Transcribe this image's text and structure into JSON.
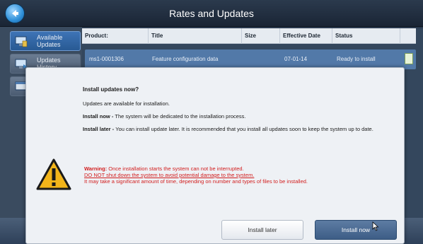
{
  "window": {
    "title": "Rates and Updates"
  },
  "sidebar": {
    "items": [
      {
        "label_line1": "Available",
        "label_line2": "Updates",
        "active": true
      },
      {
        "label_line1": "Updates",
        "label_line2": "History",
        "active": false
      },
      {
        "label_line1": "",
        "label_line2": "",
        "active": false
      }
    ]
  },
  "table": {
    "columns": [
      "Product:",
      "Title",
      "Size",
      "Effective Date",
      "Status"
    ],
    "rows": [
      {
        "product": "ms1-0001306",
        "title": "Feature configuration data",
        "size": "",
        "effective_date": "07-01-14",
        "status": "Ready to install"
      }
    ]
  },
  "dialog": {
    "heading": "Install updates now?",
    "available_text": "Updates are available for installation.",
    "install_now_label": "Install now - ",
    "install_now_text": "The system will be dedicated to the installation process.",
    "install_later_label": "Install later - ",
    "install_later_text": "You can install update later. It is recommended that you install all updates soon to keep the system up to date.",
    "warning_label": "Warning:",
    "warning_line1": " Once installation starts the system can not be interrupted.",
    "warning_line2": "DO NOT shut down the system to avoid potential damage to the system.",
    "warning_line3": "It may take a significant amount of time, depending on number and types of files to be installed.",
    "button_later": "Install later",
    "button_now": "Install now"
  },
  "colors": {
    "accent": "#3d5d86",
    "warning": "#d21e1e",
    "selected_row": "#5279a8"
  },
  "icons": [
    "back-arrow-icon",
    "updates-icon",
    "history-icon",
    "window-icon",
    "document-icon",
    "warning-icon",
    "mouse-cursor-icon"
  ]
}
